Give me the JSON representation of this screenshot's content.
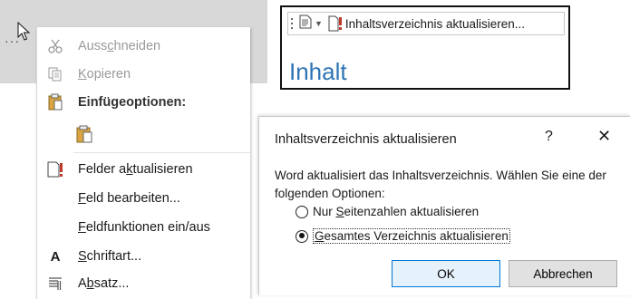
{
  "context_menu": {
    "items": [
      {
        "label_parts": [
          "Auss",
          "c",
          "hneiden"
        ],
        "icon": "scissors-icon",
        "enabled": false
      },
      {
        "label_parts": [
          "",
          "K",
          "opieren"
        ],
        "icon": "copy-icon",
        "enabled": false
      },
      {
        "label": "Einfügeoptionen:",
        "icon": "clipboard-icon",
        "type": "section"
      },
      {
        "icon": "paste-option-icon",
        "type": "paste-option"
      },
      {
        "label_parts": [
          "Felder a",
          "k",
          "tualisieren"
        ],
        "icon": "update-field-icon",
        "enabled": true
      },
      {
        "label_parts": [
          "",
          "F",
          "eld bearbeiten..."
        ],
        "enabled": true
      },
      {
        "label_parts": [
          "",
          "F",
          "eldfunktionen ein/aus"
        ],
        "enabled": true
      },
      {
        "label_parts": [
          "",
          "S",
          "chriftart..."
        ],
        "icon": "font-icon",
        "icon_text": "A",
        "enabled": true
      },
      {
        "label_parts": [
          "A",
          "b",
          "satz..."
        ],
        "icon": "paragraph-icon",
        "enabled": true
      }
    ]
  },
  "toc_toolbar": {
    "update_button_label": "Inhaltsverzeichnis aktualisieren...",
    "heading": "Inhalt"
  },
  "dialog": {
    "title": "Inhaltsverzeichnis aktualisieren",
    "help_label": "?",
    "close_label": "✕",
    "message": "Word aktualisiert das Inhaltsverzeichnis. Wählen Sie eine der folgenden Optionen:",
    "options": [
      {
        "label_parts": [
          "Nur ",
          "S",
          "eitenzahlen aktualisieren"
        ],
        "checked": false
      },
      {
        "label_parts": [
          "",
          "G",
          "esamtes Verzeichnis aktualisieren"
        ],
        "checked": true
      }
    ],
    "ok_label": "OK",
    "cancel_label": "Abbrechen"
  },
  "colors": {
    "heading_blue": "#2e74b5",
    "ok_border": "#0078d7",
    "update_red": "#c0392b"
  }
}
